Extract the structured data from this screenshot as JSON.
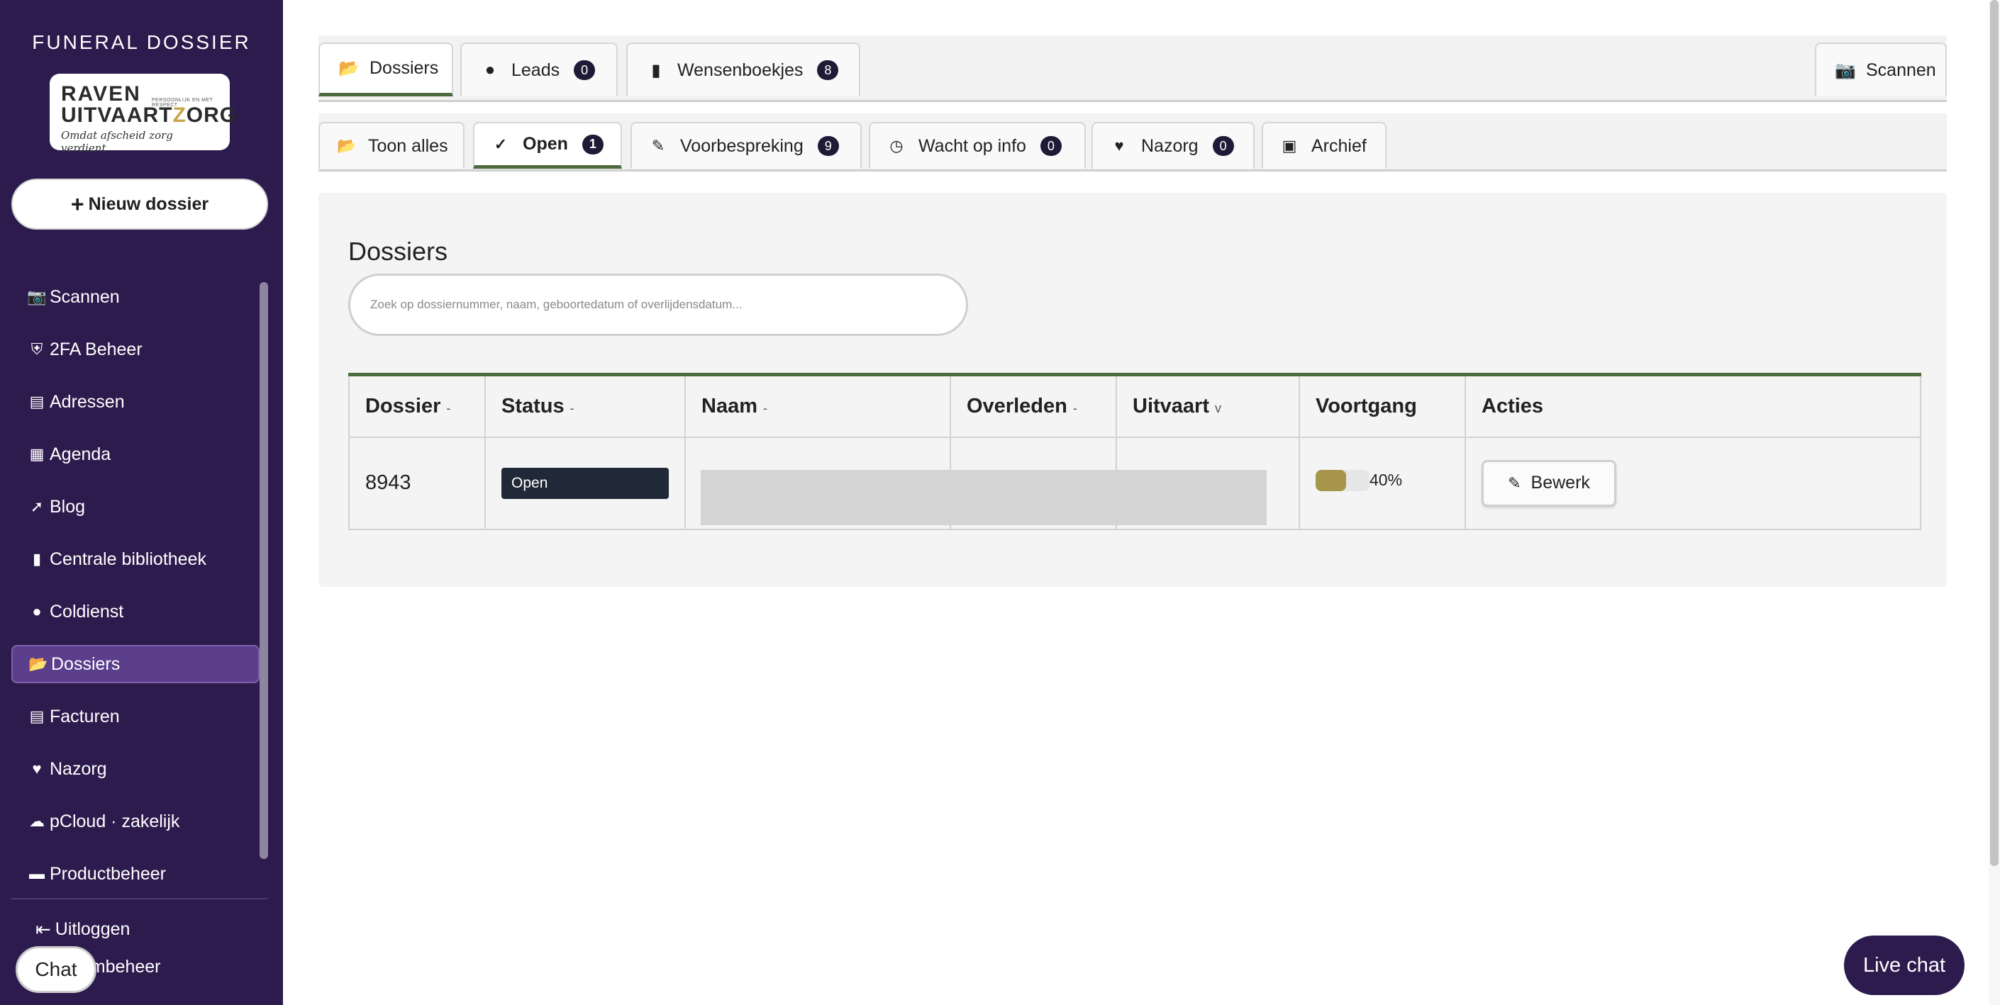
{
  "sidebar": {
    "brand_title": "FUNERAL DOSSIER",
    "logo": {
      "line1_a": "RAVEN",
      "line1_small": "PERSOONLIJK EN MET RESPECT",
      "line2_a": "UITVAART",
      "line2_b": "Z",
      "line2_c": "ORG",
      "tagline": "Omdat afscheid zorg verdient"
    },
    "new_button": {
      "icon": "plus-icon",
      "label": "Nieuw dossier"
    },
    "items": [
      {
        "icon": "camera-icon",
        "label": "Scannen"
      },
      {
        "icon": "shield-icon",
        "label": "2FA Beheer"
      },
      {
        "icon": "address-book-icon",
        "label": "Adressen"
      },
      {
        "icon": "calendar-icon",
        "label": "Agenda"
      },
      {
        "icon": "pin-icon",
        "label": "Blog"
      },
      {
        "icon": "book-icon",
        "label": "Centrale bibliotheek"
      },
      {
        "icon": "users-icon",
        "label": "Coldienst"
      },
      {
        "icon": "folder-open-icon",
        "label": "Dossiers",
        "active": true
      },
      {
        "icon": "invoice-icon",
        "label": "Facturen"
      },
      {
        "icon": "heart-icon",
        "label": "Nazorg"
      },
      {
        "icon": "cloud-icon",
        "label": "pCloud · zakelijk"
      },
      {
        "icon": "cart-icon",
        "label": "Productbeheer"
      }
    ],
    "logout": {
      "icon": "logout-icon",
      "label": "Uitloggen"
    },
    "system_label": "eembeheer",
    "chat_label": "Chat"
  },
  "main_tabs": [
    {
      "icon": "folder-open-icon",
      "label": "Dossiers",
      "active": true
    },
    {
      "icon": "users-icon",
      "label": "Leads",
      "badge": "0"
    },
    {
      "icon": "book-icon",
      "label": "Wensenboekjes",
      "badge": "8"
    },
    {
      "icon": "camera-icon",
      "label": "Scannen"
    }
  ],
  "filter_tabs": [
    {
      "icon": "folder-open-icon",
      "label": "Toon alles"
    },
    {
      "icon": "check-icon",
      "label": "Open",
      "badge": "1",
      "active": true
    },
    {
      "icon": "pencil-icon",
      "label": "Voorbespreking",
      "badge": "9"
    },
    {
      "icon": "clock-icon",
      "label": "Wacht op info",
      "badge": "0"
    },
    {
      "icon": "heart-icon",
      "label": "Nazorg",
      "badge": "0"
    },
    {
      "icon": "archive-icon",
      "label": "Archief"
    }
  ],
  "dossiers": {
    "title": "Dossiers",
    "search_placeholder": "Zoek op dossiernummer, naam, geboortedatum of overlijdensdatum...",
    "columns": [
      {
        "label": "Dossier",
        "sort": "-"
      },
      {
        "label": "Status",
        "sort": "-"
      },
      {
        "label": "Naam",
        "sort": "-"
      },
      {
        "label": "Overleden",
        "sort": "-"
      },
      {
        "label": "Uitvaart",
        "sort": "v"
      },
      {
        "label": "Voortgang",
        "sort": ""
      },
      {
        "label": "Acties",
        "sort": ""
      }
    ],
    "rows": [
      {
        "dossier": "8943",
        "status": "Open",
        "naam": "",
        "overleden": "",
        "uitvaart": "",
        "progress": 40,
        "progress_label": "40%",
        "action_label": "Bewerk",
        "action_icon": "pencil-icon"
      }
    ]
  },
  "livechat_label": "Live chat",
  "colors": {
    "sidebar": "#2d1b4e",
    "accent_green": "#4d6b3c",
    "progress": "#a8954c",
    "badge": "#1f1a36"
  }
}
